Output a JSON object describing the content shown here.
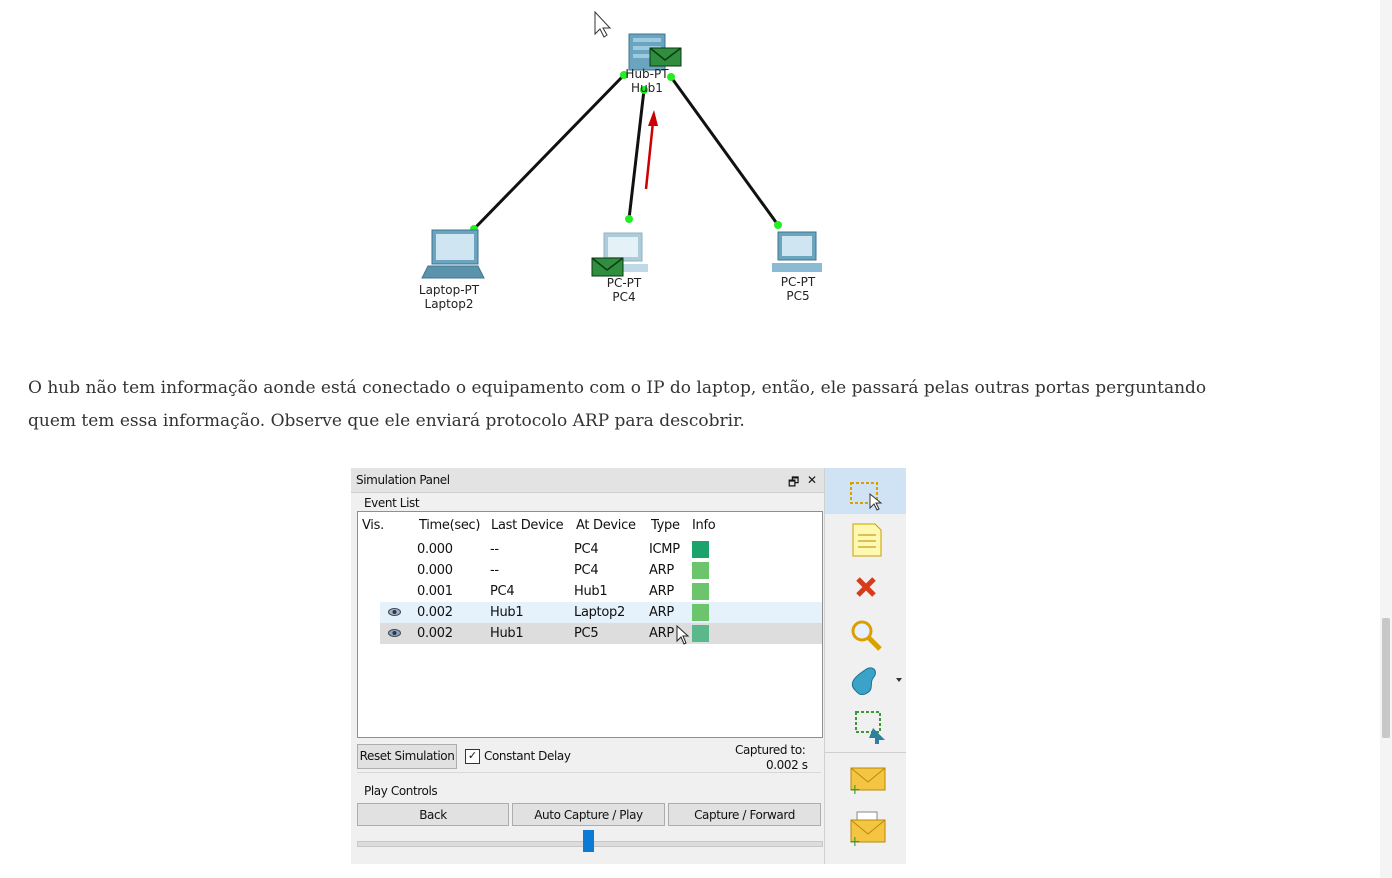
{
  "topology": {
    "hub": {
      "type": "Hub-PT",
      "name": "Hub1"
    },
    "devices": [
      {
        "type": "Laptop-PT",
        "name": "Laptop2"
      },
      {
        "type": "PC-PT",
        "name": "PC4"
      },
      {
        "type": "PC-PT",
        "name": "PC5"
      }
    ]
  },
  "article": {
    "paragraph": "O hub não tem informação aonde está conectado o equipamento com o IP do laptop, então, ele passará pelas outras portas perguntando quem tem essa informação. Observe que ele enviará protocolo ARP para descobrir."
  },
  "simulation_panel": {
    "title": "Simulation Panel",
    "restore_glyph": "🗗",
    "close_glyph": "✕",
    "event_list_label": "Event List",
    "columns": [
      "Vis.",
      "Time(sec)",
      "Last Device",
      "At Device",
      "Type",
      "Info"
    ],
    "rows": [
      {
        "time": "0.000",
        "last": "--",
        "at": "PC4",
        "type": "ICMP",
        "color": "#1aa36a",
        "visible": false
      },
      {
        "time": "0.000",
        "last": "--",
        "at": "PC4",
        "type": "ARP",
        "color": "#6cc46c",
        "visible": false
      },
      {
        "time": "0.001",
        "last": "PC4",
        "at": "Hub1",
        "type": "ARP",
        "color": "#6cc46c",
        "visible": false
      },
      {
        "time": "0.002",
        "last": "Hub1",
        "at": "Laptop2",
        "type": "ARP",
        "color": "#6cc46c",
        "visible": true
      },
      {
        "time": "0.002",
        "last": "Hub1",
        "at": "PC5",
        "type": "ARP",
        "color": "#5ab88a",
        "visible": true
      }
    ],
    "reset_button": "Reset Simulation",
    "constant_delay_label": "Constant Delay",
    "constant_delay_checked": "✓",
    "captured_label": "Captured to:",
    "captured_value": "0.002 s",
    "play_controls_label": "Play Controls",
    "back_button": "Back",
    "auto_capture_button": "Auto Capture / Play",
    "capture_forward_button": "Capture / Forward"
  },
  "toolbar": {
    "items": [
      "select-icon",
      "note-icon",
      "delete-icon",
      "inspect-icon",
      "draw-shape-icon",
      "resize-icon",
      "add-simple-pdu-icon",
      "add-complex-pdu-icon"
    ]
  }
}
